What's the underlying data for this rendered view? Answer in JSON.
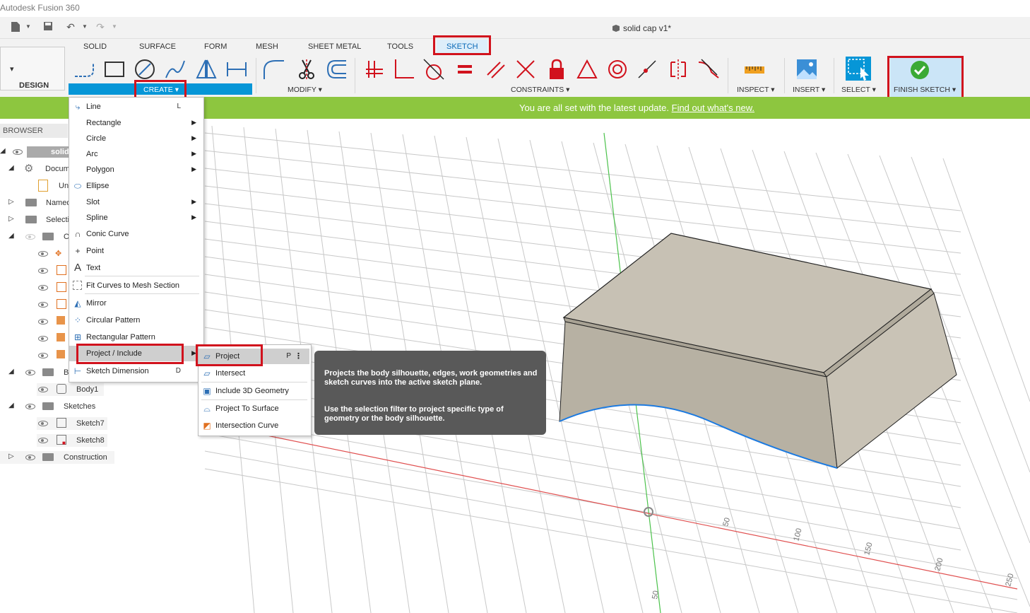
{
  "app": {
    "window_title": "Autodesk Fusion 360",
    "document_title": "solid cap v1*"
  },
  "workspace": {
    "label": "DESIGN"
  },
  "tabs": [
    "SOLID",
    "SURFACE",
    "FORM",
    "MESH",
    "SHEET METAL",
    "TOOLS",
    "SKETCH"
  ],
  "toolbar_groups": {
    "create": "CREATE",
    "modify": "MODIFY",
    "constraints": "CONSTRAINTS",
    "inspect": "INSPECT",
    "insert": "INSERT",
    "select": "SELECT",
    "finish": "FINISH SKETCH"
  },
  "banner": {
    "message": "You are all set with the latest update.",
    "link": "Find out what's new."
  },
  "browser": {
    "title": "BROWSER",
    "items": [
      "solid",
      "Docum",
      "Un",
      "Named",
      "Selecti",
      "O",
      "B",
      "Body1",
      "Sketches",
      "Sketch7",
      "Sketch8",
      "Construction"
    ]
  },
  "create_menu": {
    "items": [
      {
        "label": "Line",
        "shortcut": "L"
      },
      {
        "label": "Rectangle"
      },
      {
        "label": "Circle"
      },
      {
        "label": "Arc"
      },
      {
        "label": "Polygon"
      },
      {
        "label": "Ellipse"
      },
      {
        "label": "Slot"
      },
      {
        "label": "Spline"
      },
      {
        "label": "Conic Curve"
      },
      {
        "label": "Point"
      },
      {
        "label": "Text"
      },
      {
        "label": "Fit Curves to Mesh Section"
      },
      {
        "label": "Mirror"
      },
      {
        "label": "Circular Pattern"
      },
      {
        "label": "Rectangular Pattern"
      },
      {
        "label": "Project / Include"
      },
      {
        "label": "Sketch Dimension",
        "shortcut": "D"
      }
    ]
  },
  "project_submenu": {
    "items": [
      {
        "label": "Project",
        "shortcut": "P"
      },
      {
        "label": "Intersect"
      },
      {
        "label": "Include 3D Geometry"
      },
      {
        "label": "Project To Surface"
      },
      {
        "label": "Intersection Curve"
      }
    ]
  },
  "tooltip": {
    "line1": "Projects the body silhouette, edges, work geometries and sketch curves into the active sketch plane.",
    "line2": "Use the selection filter to project specific type of geometry or the body silhouette."
  },
  "axis_ticks": {
    "x": [
      "50",
      "100",
      "150",
      "200",
      "250"
    ],
    "y": [
      "50"
    ]
  },
  "colors": {
    "accent": "#0696d7",
    "banner": "#8dc63f",
    "highlight": "#d1121d"
  }
}
